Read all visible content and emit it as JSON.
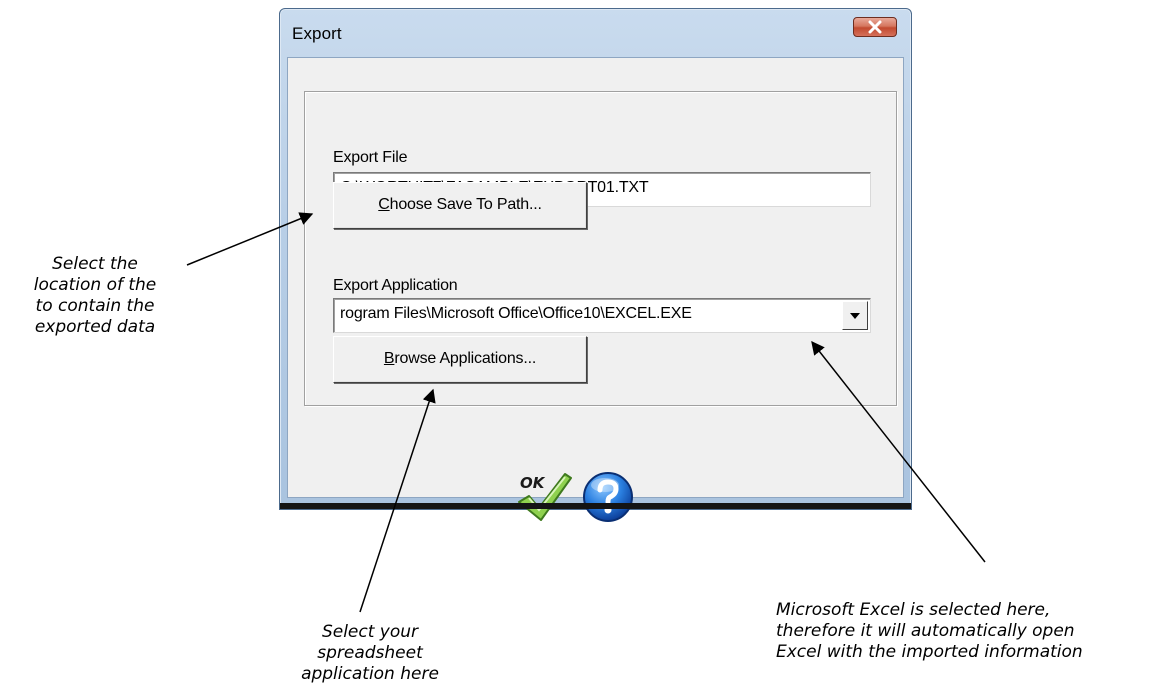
{
  "window": {
    "title": "Export",
    "close_icon": "close-x-icon"
  },
  "export_file": {
    "label": "Export File",
    "value": "C:\\WORTHIT7\\FASAMPLE\\EXPORT01.TXT",
    "button_prefix": "C",
    "button_rest": "hoose Save To Path..."
  },
  "export_application": {
    "label": "Export Application",
    "value": "rogram Files\\Microsoft Office\\Office10\\EXCEL.EXE",
    "dropdown_icon": "chevron-down-icon",
    "button_prefix": "B",
    "button_rest": "rowse Applications..."
  },
  "footer": {
    "ok_icon_label": "OK",
    "ok_icon": "ok-checkmark-icon",
    "help_icon": "help-question-icon"
  },
  "annotations": {
    "location_lines": [
      "Select the",
      "location of the",
      "to contain the",
      "exported data"
    ],
    "spreadsheet_lines": [
      "Select your",
      "spreadsheet",
      "application here"
    ],
    "excel_lines": [
      "Microsoft Excel is selected here,",
      "therefore it will automatically open",
      "Excel with the imported information"
    ]
  },
  "colors": {
    "title_bar": "#b9cfe7",
    "close_button": "#c24a30",
    "help_blue": "#1f6fd1",
    "ok_green": "#7cc43a"
  }
}
